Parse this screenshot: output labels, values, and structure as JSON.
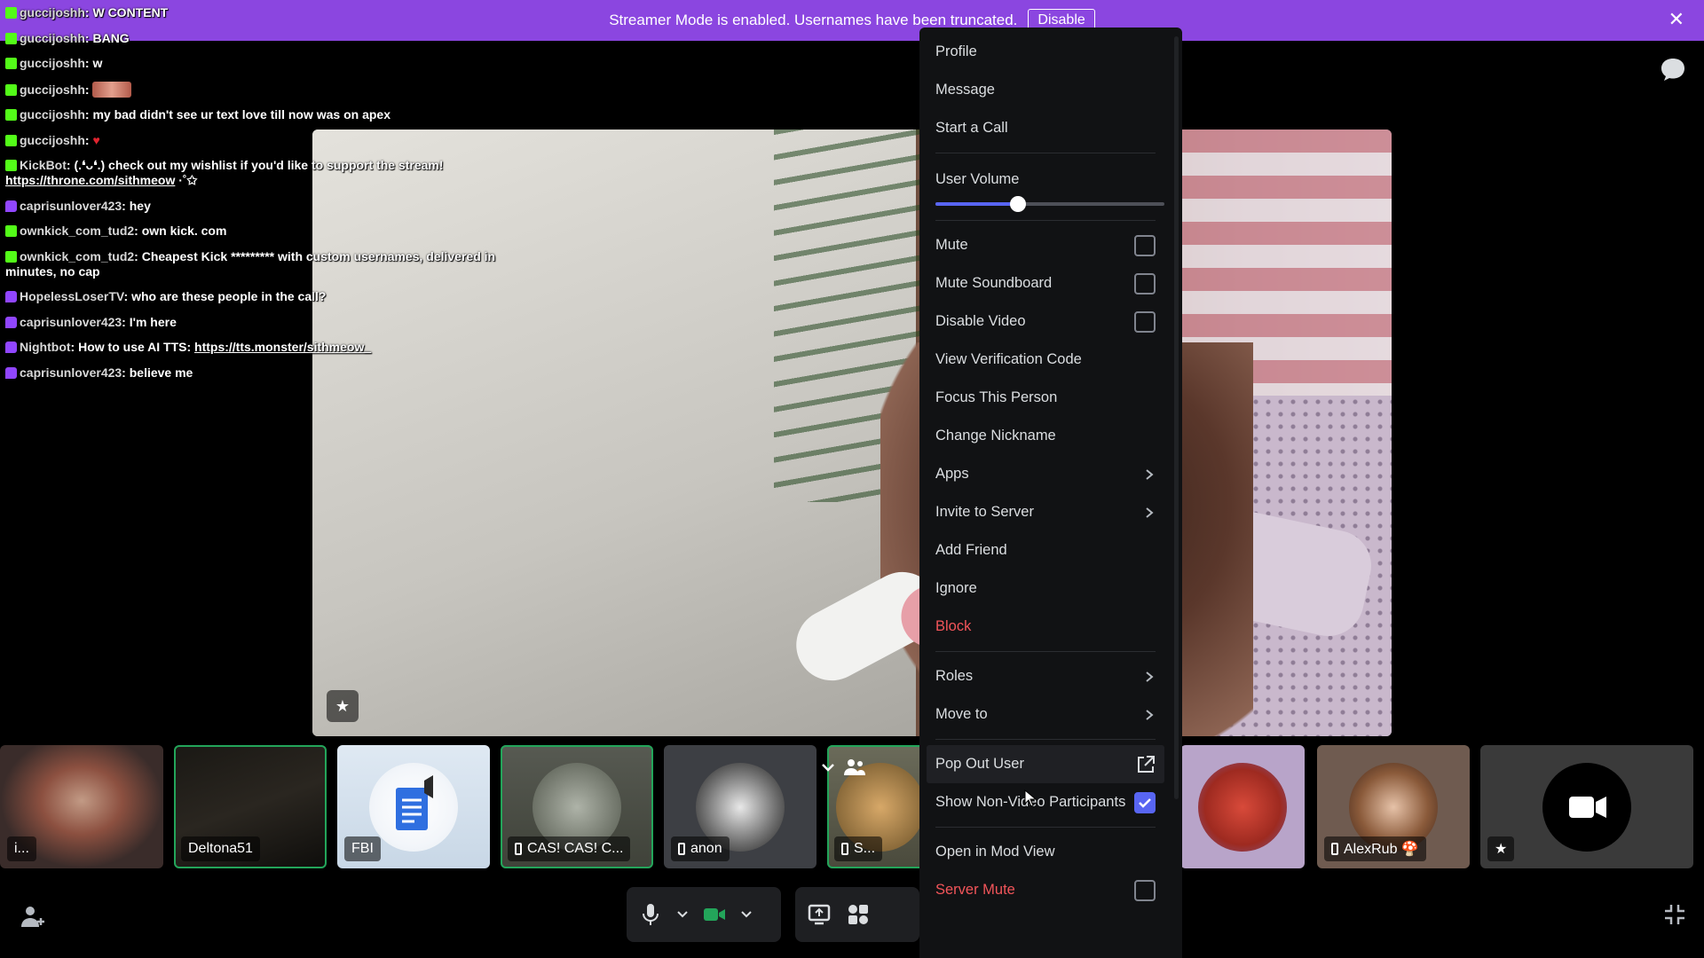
{
  "banner": {
    "text": "Streamer Mode is enabled. Usernames have been truncated.",
    "disable_label": "Disable",
    "close_icon": "close-icon"
  },
  "chat": [
    {
      "platform": "kick",
      "user": "guccijoshh",
      "msg": "W CONTENT"
    },
    {
      "platform": "kick",
      "user": "guccijoshh",
      "msg": "BANG"
    },
    {
      "platform": "kick",
      "user": "guccijoshh",
      "msg": "w"
    },
    {
      "platform": "kick",
      "user": "guccijoshh",
      "msg": "",
      "emote": true
    },
    {
      "platform": "kick",
      "user": "guccijoshh",
      "msg": "my bad didn't see ur text love till now was on apex"
    },
    {
      "platform": "kick",
      "user": "guccijoshh",
      "msg": "",
      "heart": "♥"
    },
    {
      "platform": "kick",
      "user": "KickBot",
      "msg": "(.❛ᴗ❛.) check out my wishlist if you'd like to support the stream!",
      "link": "https://throne.com/sithmeow",
      "after": " ·˚✩"
    },
    {
      "platform": "twitch",
      "user": "caprisunlover423",
      "msg": "hey"
    },
    {
      "platform": "kick",
      "user": "ownkick_com_tud2",
      "msg": "own kick. com"
    },
    {
      "platform": "kick",
      "user": "ownkick_com_tud2",
      "msg": "Cheapest Kick ********* with custom usernames, delivered in minutes, no cap"
    },
    {
      "platform": "twitch",
      "user": "HopelessLoserTV",
      "msg": "who are these people in the call?"
    },
    {
      "platform": "twitch",
      "user": "caprisunlover423",
      "msg": "I'm here"
    },
    {
      "platform": "twitch",
      "user": "Nightbot",
      "msg": "How to use AI TTS: ",
      "link": "https://tts.monster/sithmeow_"
    },
    {
      "platform": "twitch",
      "user": "caprisunlover423",
      "msg": "believe me"
    }
  ],
  "tiles": [
    {
      "label": "i...",
      "kind": "video-man"
    },
    {
      "label": "Deltona51",
      "kind": "dark",
      "speaking": true
    },
    {
      "label": "FBI",
      "kind": "doc"
    },
    {
      "label": "CAS! CAS! C...",
      "kind": "plane",
      "mobile": true,
      "speaking": true
    },
    {
      "label": "anon",
      "kind": "bw",
      "mobile": true
    },
    {
      "label": "S...",
      "kind": "kid",
      "mobile": true,
      "speaking": true
    },
    {
      "label": "",
      "kind": "monster"
    },
    {
      "label": "AlexRub 🍄",
      "kind": "man",
      "mobile": true
    },
    {
      "label": "★",
      "kind": "camera"
    }
  ],
  "menu": {
    "items_top": [
      "Profile",
      "Message",
      "Start a Call"
    ],
    "user_volume_label": "User Volume",
    "user_volume": 0.36,
    "toggles": [
      {
        "label": "Mute",
        "checked": false
      },
      {
        "label": "Mute Soundboard",
        "checked": false
      },
      {
        "label": "Disable Video",
        "checked": false
      }
    ],
    "items_mid": [
      {
        "label": "View Verification Code"
      },
      {
        "label": "Focus This Person"
      },
      {
        "label": "Change Nickname"
      },
      {
        "label": "Apps",
        "submenu": true
      },
      {
        "label": "Invite to Server",
        "submenu": true
      },
      {
        "label": "Add Friend"
      },
      {
        "label": "Ignore"
      },
      {
        "label": "Block",
        "danger": true
      }
    ],
    "items_roles": [
      {
        "label": "Roles",
        "submenu": true
      },
      {
        "label": "Move to",
        "submenu": true
      }
    ],
    "pop_out_label": "Pop Out User",
    "show_non_video_label": "Show Non-Video Participants",
    "show_non_video_checked": true,
    "mod_view_label": "Open in Mod View",
    "server_mute_label": "Server Mute"
  },
  "colors": {
    "banner": "#8b46e0",
    "accent": "#5865f2",
    "danger": "#f2555a",
    "speaking": "#23a55a",
    "camera_on": "#23a55a"
  }
}
